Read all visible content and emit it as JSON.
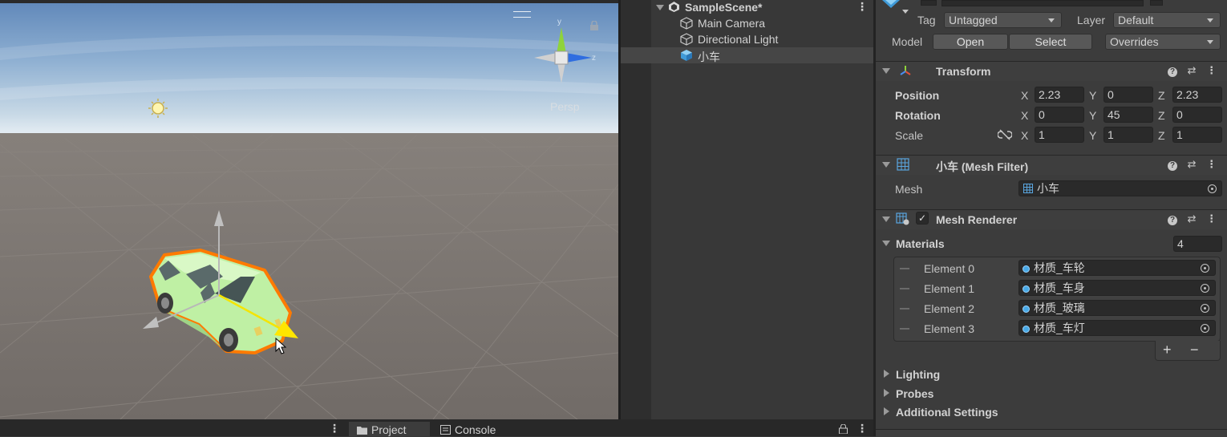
{
  "scene_view": {
    "projection_label": "Persp",
    "gizmo_axes": [
      "y",
      "z"
    ]
  },
  "hierarchy": {
    "scene_name": "SampleScene*",
    "items": [
      {
        "label": "Main Camera",
        "icon": "gameobject-icon"
      },
      {
        "label": "Directional Light",
        "icon": "gameobject-icon"
      },
      {
        "label": "小车",
        "icon": "prefab-icon",
        "selected": true
      }
    ]
  },
  "bottom_tabs": [
    {
      "label": "Project",
      "icon": "folder-icon",
      "active": true
    },
    {
      "label": "Console",
      "icon": "console-icon",
      "active": false
    }
  ],
  "inspector": {
    "tag_label": "Tag",
    "tag_value": "Untagged",
    "layer_label": "Layer",
    "layer_value": "Default",
    "model_label": "Model",
    "open_button": "Open",
    "select_button": "Select",
    "overrides_value": "Overrides",
    "transform": {
      "title": "Transform",
      "position_label": "Position",
      "rotation_label": "Rotation",
      "scale_label": "Scale",
      "position": {
        "x": "2.23",
        "y": "0",
        "z": "2.23"
      },
      "rotation": {
        "x": "0",
        "y": "45",
        "z": "0"
      },
      "scale": {
        "x": "1",
        "y": "1",
        "z": "1"
      },
      "axis_labels": {
        "x": "X",
        "y": "Y",
        "z": "Z"
      }
    },
    "mesh_filter": {
      "title": "小车 (Mesh Filter)",
      "mesh_label": "Mesh",
      "mesh_value": "小车"
    },
    "mesh_renderer": {
      "title": "Mesh Renderer",
      "enabled": true,
      "materials_label": "Materials",
      "materials_count": "4",
      "elements": [
        {
          "label": "Element 0",
          "value": "材质_车轮"
        },
        {
          "label": "Element 1",
          "value": "材质_车身"
        },
        {
          "label": "Element 2",
          "value": "材质_玻璃"
        },
        {
          "label": "Element 3",
          "value": "材质_车灯"
        }
      ],
      "add_label": "+",
      "remove_label": "−"
    },
    "foldouts": [
      {
        "label": "Lighting"
      },
      {
        "label": "Probes"
      },
      {
        "label": "Additional Settings"
      }
    ]
  },
  "colors": {
    "car_body": "#bff0a4",
    "selection_outline": "#ff7a00",
    "gizmo_y": "#8fd33b",
    "gizmo_z": "#2f6de0",
    "material_dot": "#49a9e6"
  }
}
